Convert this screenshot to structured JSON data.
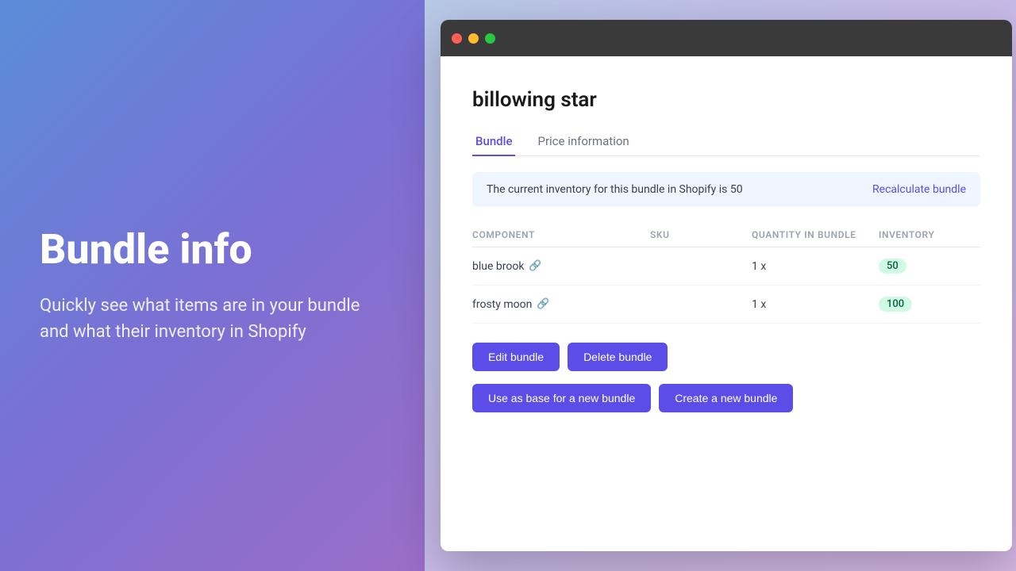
{
  "left": {
    "title": "Bundle info",
    "description": "Quickly see what items are in your bundle and what their inventory in Shopify"
  },
  "browser": {
    "page_title": "billowing star",
    "tabs": [
      {
        "id": "bundle",
        "label": "Bundle",
        "active": true
      },
      {
        "id": "price-info",
        "label": "Price information",
        "active": false
      }
    ],
    "banner": {
      "text": "The current inventory for this bundle in Shopify is 50",
      "action_label": "Recalculate bundle"
    },
    "table": {
      "columns": [
        {
          "id": "component",
          "label": "COMPONENT"
        },
        {
          "id": "sku",
          "label": "SKU"
        },
        {
          "id": "quantity",
          "label": "QUANTITY IN BUNDLE"
        },
        {
          "id": "inventory",
          "label": "INVENTORY"
        }
      ],
      "rows": [
        {
          "component": "blue brook",
          "sku": "",
          "quantity": "1 x",
          "inventory": "50",
          "inventory_color": "green"
        },
        {
          "component": "frosty moon",
          "sku": "",
          "quantity": "1 x",
          "inventory": "100",
          "inventory_color": "green"
        }
      ]
    },
    "action_buttons": {
      "edit_label": "Edit bundle",
      "delete_label": "Delete bundle"
    },
    "secondary_buttons": {
      "use_as_base_label": "Use as base for a new bundle",
      "create_new_label": "Create a new bundle"
    }
  },
  "icons": {
    "link": "🔗",
    "red_dot": "●",
    "yellow_dot": "●",
    "green_dot": "●"
  }
}
